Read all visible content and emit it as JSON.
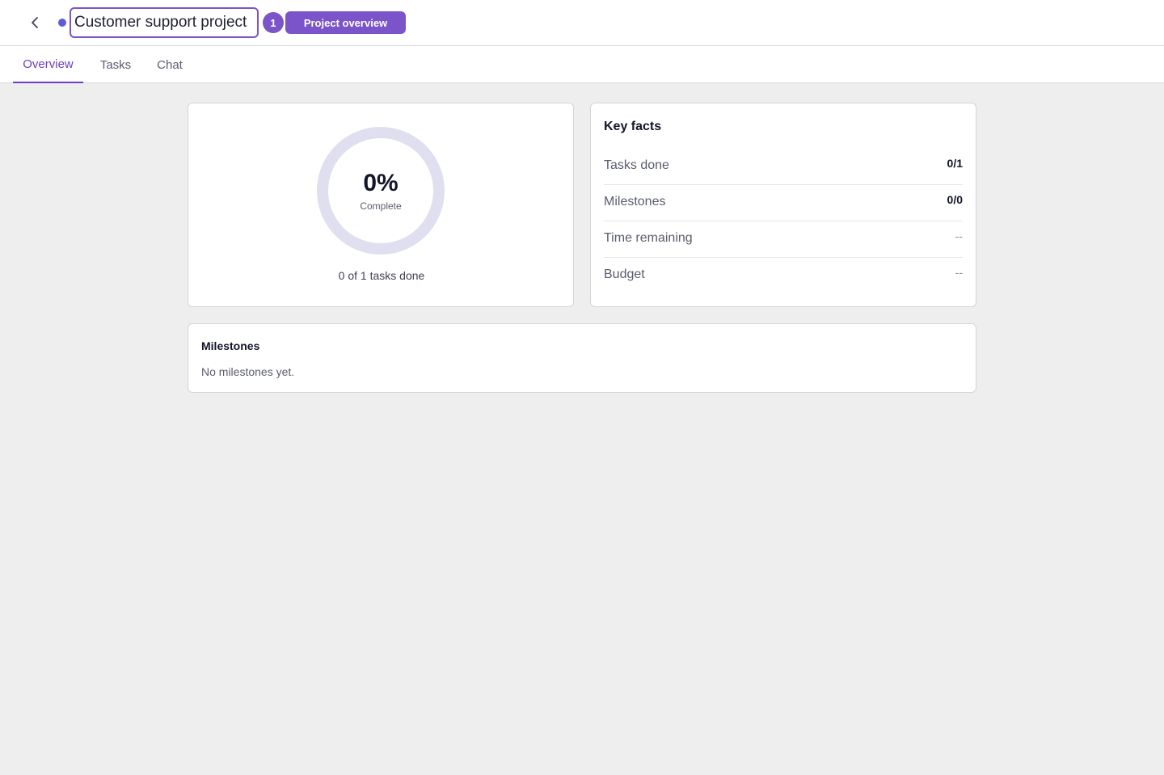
{
  "header": {
    "back_icon": "chevron-left-icon",
    "status_color": "#5b5bdb",
    "project_title": "Customer support project",
    "step_number": "1",
    "overview_pill": "Project overview"
  },
  "tabs": [
    {
      "label": "Overview",
      "active": true
    },
    {
      "label": "Tasks",
      "active": false
    },
    {
      "label": "Chat",
      "active": false
    }
  ],
  "progress": {
    "percent_label": "0%",
    "percent_value": 0,
    "complete_label": "Complete",
    "tasks_summary": "0 of 1 tasks done",
    "ring_track_color": "#e0dfef",
    "ring_fill_color": "#7a54c8"
  },
  "key_facts": {
    "title": "Key facts",
    "rows": [
      {
        "label": "Tasks done",
        "value": "0/1"
      },
      {
        "label": "Milestones",
        "value": "0/0"
      },
      {
        "label": "Time remaining",
        "value": "--"
      },
      {
        "label": "Budget",
        "value": "--"
      }
    ]
  },
  "milestones": {
    "title": "Milestones",
    "empty_text": "No milestones yet."
  },
  "colors": {
    "accent": "#7a54c8",
    "background": "#eeeeee"
  }
}
